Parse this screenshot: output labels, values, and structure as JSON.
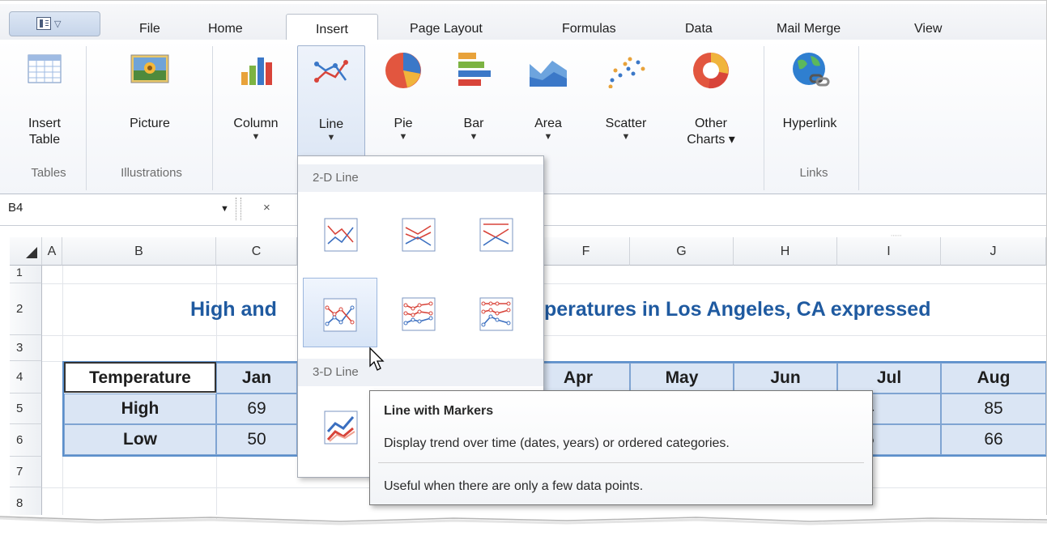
{
  "tabs": {
    "file": "File",
    "home": "Home",
    "insert": "Insert",
    "page_layout": "Page Layout",
    "formulas": "Formulas",
    "data": "Data",
    "mail_merge": "Mail Merge",
    "view": "View"
  },
  "ribbon": {
    "insert_table_l1": "Insert",
    "insert_table_l2": "Table",
    "picture": "Picture",
    "column": "Column",
    "line": "Line",
    "pie": "Pie",
    "bar": "Bar",
    "area": "Area",
    "scatter": "Scatter",
    "other_l1": "Other",
    "other_l2": "Charts ▾",
    "hyperlink": "Hyperlink",
    "groups": {
      "tables": "Tables",
      "illustrations": "Illustrations",
      "links": "Links"
    }
  },
  "formula_bar": {
    "name_box": "B4",
    "cancel": "×"
  },
  "columns": [
    "A",
    "B",
    "C",
    "D",
    "E",
    "F",
    "G",
    "H",
    "I",
    "J"
  ],
  "rows": [
    "1",
    "2",
    "3",
    "4",
    "5",
    "6",
    "7",
    "8"
  ],
  "sheet": {
    "title_visible_left": "High and",
    "title_visible_right": "peratures in Los Angeles, CA expressed",
    "header_label": "Temperature",
    "months_visible": {
      "jan": "Jan",
      "apr": "Apr",
      "may": "May",
      "jun": "Jun",
      "jul": "Jul",
      "aug": "Aug"
    },
    "high_label": "High",
    "low_label": "Low",
    "high": {
      "jan": "69",
      "jul": "84",
      "aug": "85"
    },
    "low": {
      "jan": "50",
      "jul": "65",
      "aug": "66"
    }
  },
  "gallery": {
    "section_2d": "2-D Line",
    "section_3d": "3-D Line"
  },
  "tooltip": {
    "title": "Line with Markers",
    "line1": "Display trend over time (dates, years) or ordered categories.",
    "line2": "Useful when there are only a few data points."
  },
  "colors": {
    "title_blue": "#1f5aa0",
    "table_fill": "#dae5f4",
    "table_border": "#5b8fcb"
  }
}
